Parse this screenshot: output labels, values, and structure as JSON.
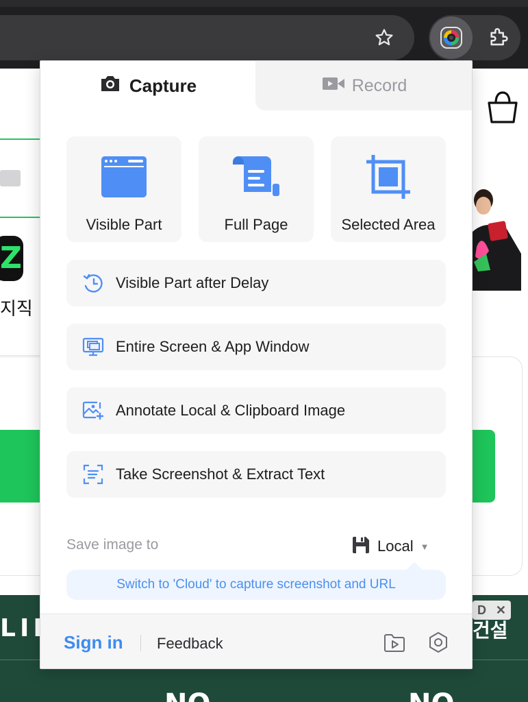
{
  "browser": {
    "star_icon": "star-icon",
    "extension_icon": "camera-lens-icon",
    "puzzle_icon": "puzzle-icon"
  },
  "background_page": {
    "korean_text": "지직",
    "banner_text": "LIF",
    "banner_korean": "건설",
    "ad_label": "D",
    "ad_close": "✕",
    "banner_bottom_left": "NO",
    "banner_bottom_right": "NO"
  },
  "popup": {
    "tabs": [
      {
        "label": "Capture",
        "icon": "camera-icon",
        "active": true
      },
      {
        "label": "Record",
        "icon": "video-camera-icon",
        "active": false
      }
    ],
    "tiles": [
      {
        "label": "Visible Part",
        "icon": "browser-window-icon"
      },
      {
        "label": "Full Page",
        "icon": "scroll-page-icon"
      },
      {
        "label": "Selected Area",
        "icon": "crop-icon"
      }
    ],
    "actions": [
      {
        "label": "Visible Part after Delay",
        "icon": "timer-icon"
      },
      {
        "label": "Entire Screen & App Window",
        "icon": "monitor-windows-icon"
      },
      {
        "label": "Annotate Local & Clipboard Image",
        "icon": "image-add-icon"
      },
      {
        "label": "Take Screenshot & Extract Text",
        "icon": "text-scan-icon"
      }
    ],
    "save": {
      "label": "Save image to",
      "value": "Local",
      "icon": "floppy-disk-icon"
    },
    "hint": "Switch to 'Cloud' to capture screenshot and URL",
    "footer": {
      "sign_in": "Sign in",
      "feedback": "Feedback",
      "folder_icon": "video-folder-icon",
      "settings_icon": "settings-hex-icon"
    },
    "colors": {
      "accent": "#3d8bf0",
      "icon_blue": "#4f8ff5",
      "tile_bg": "#f6f6f7"
    }
  }
}
